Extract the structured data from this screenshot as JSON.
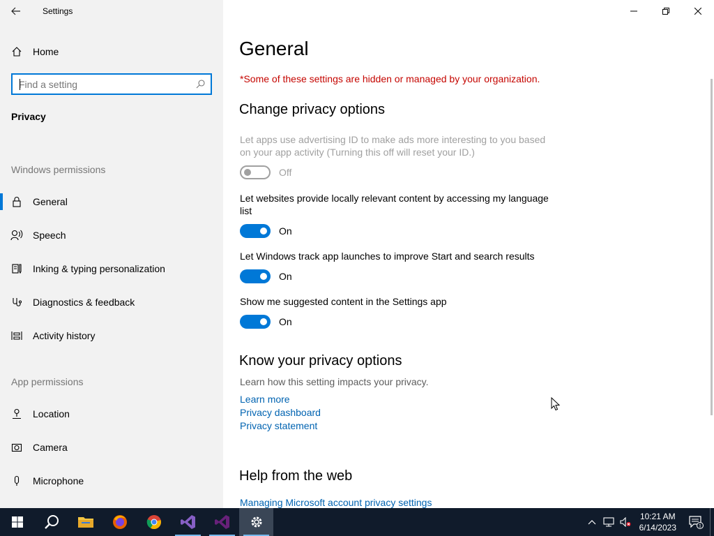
{
  "window": {
    "title": "Settings",
    "back_glyph": "←",
    "minimize_glyph": "—",
    "maximize_glyph": "❐",
    "close_glyph": "✕"
  },
  "sidebar": {
    "home_label": "Home",
    "search_placeholder": "Find a setting",
    "section_title": "Privacy",
    "windows_permissions_label": "Windows permissions",
    "windows_permissions_items": [
      {
        "label": "General",
        "icon": "lock-icon",
        "selected": true
      },
      {
        "label": "Speech",
        "icon": "speech-icon"
      },
      {
        "label": "Inking & typing personalization",
        "icon": "inking-icon"
      },
      {
        "label": "Diagnostics & feedback",
        "icon": "diagnostics-icon"
      },
      {
        "label": "Activity history",
        "icon": "activity-history-icon"
      }
    ],
    "app_permissions_label": "App permissions",
    "app_permissions_items": [
      {
        "label": "Location",
        "icon": "location-icon"
      },
      {
        "label": "Camera",
        "icon": "camera-icon"
      },
      {
        "label": "Microphone",
        "icon": "microphone-icon"
      }
    ]
  },
  "main": {
    "page_title": "General",
    "managed_notice": "*Some of these settings are hidden or managed by your organization.",
    "change_privacy_heading": "Change privacy options",
    "options": [
      {
        "text": "Let apps use advertising ID to make ads more interesting to you based on your app activity (Turning this off will reset your ID.)",
        "state": "Off",
        "disabled": true
      },
      {
        "text": "Let websites provide locally relevant content by accessing my language list",
        "state": "On",
        "disabled": false
      },
      {
        "text": "Let Windows track app launches to improve Start and search results",
        "state": "On",
        "disabled": false
      },
      {
        "text": "Show me suggested content in the Settings app",
        "state": "On",
        "disabled": false
      }
    ],
    "know_heading": "Know your privacy options",
    "know_desc": "Learn how this setting impacts your privacy.",
    "links": [
      "Learn more",
      "Privacy dashboard",
      "Privacy statement"
    ],
    "help_heading": "Help from the web",
    "help_link": "Managing Microsoft account privacy settings"
  },
  "taskbar": {
    "apps": [
      "start-icon",
      "search-icon",
      "file-explorer-icon",
      "firefox-icon",
      "chrome-icon",
      "visual-studio-icon",
      "visual-studio-2-icon",
      "settings-gear-icon"
    ],
    "active_app": "settings-gear-icon",
    "time": "10:21 AM",
    "date": "6/14/2023",
    "notification_count": "1"
  },
  "colors": {
    "accent": "#0078d7",
    "warning": "#c50500",
    "link": "#0063b1",
    "taskbar": "#101b2b"
  }
}
